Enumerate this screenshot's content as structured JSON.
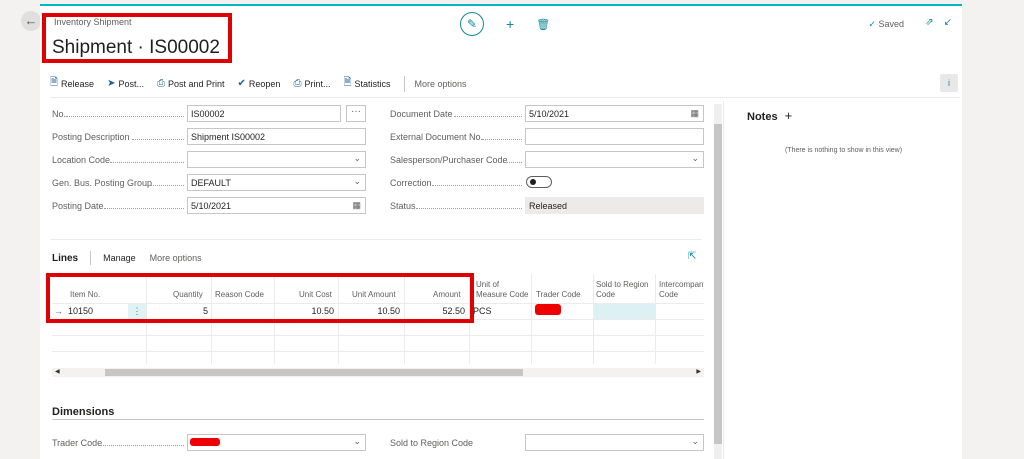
{
  "header": {
    "back_icon": "arrow-left-icon",
    "caption": "Inventory Shipment",
    "title": "Shipment · IS00002",
    "saved_status": "Saved"
  },
  "actions": [
    {
      "label": "Release",
      "icon": "release-icon"
    },
    {
      "label": "Post...",
      "icon": "post-icon"
    },
    {
      "label": "Post and Print",
      "icon": "post-print-icon"
    },
    {
      "label": "Reopen",
      "icon": "reopen-icon"
    },
    {
      "label": "Print...",
      "icon": "print-icon"
    },
    {
      "label": "Statistics",
      "icon": "statistics-icon"
    }
  ],
  "more_options": "More options",
  "general": {
    "no_label": "No.",
    "no_value": "IS00002",
    "posting_description_label": "Posting Description",
    "posting_description_value": "Shipment IS00002",
    "location_code_label": "Location Code",
    "location_code_value": "",
    "gen_bus_posting_group_label": "Gen. Bus. Posting Group",
    "gen_bus_posting_group_value": "DEFAULT",
    "posting_date_label": "Posting Date",
    "posting_date_value": "5/10/2021",
    "document_date_label": "Document Date",
    "document_date_value": "5/10/2021",
    "external_document_no_label": "External Document No.",
    "external_document_no_value": "",
    "salesperson_label": "Salesperson/Purchaser Code",
    "salesperson_value": "",
    "correction_label": "Correction",
    "correction_value": false,
    "status_label": "Status",
    "status_value": "Released"
  },
  "lines": {
    "title": "Lines",
    "manage": "Manage",
    "more_options": "More options",
    "columns": {
      "item_no": "Item No.",
      "quantity": "Quantity",
      "reason_code": "Reason Code",
      "unit_cost": "Unit Cost",
      "unit_amount": "Unit Amount",
      "amount": "Amount",
      "uom_line1": "Unit of",
      "uom_line2": "Measure Code",
      "trader_code": "Trader Code",
      "sold_to_line1": "Sold to Region",
      "sold_to_line2": "Code",
      "interco_line1": "Intercompany",
      "interco_line2": "Code"
    },
    "row": {
      "item_no": "10150",
      "quantity": "5",
      "reason_code": "",
      "unit_cost": "10.50",
      "unit_amount": "10.50",
      "amount": "52.50",
      "uom": "PCS",
      "trader_code": "",
      "sold_to_region": "",
      "intercompany": ""
    }
  },
  "dimensions": {
    "title": "Dimensions",
    "trader_code_label": "Trader Code",
    "trader_code_value": "",
    "sold_to_region_label": "Sold to Region Code",
    "sold_to_region_value": ""
  },
  "notes": {
    "title": "Notes",
    "add_icon": "plus-icon",
    "empty_text": "(There is nothing to show in this view)"
  },
  "colors": {
    "accent": "#0e8a9a",
    "highlight": "#e00000"
  }
}
